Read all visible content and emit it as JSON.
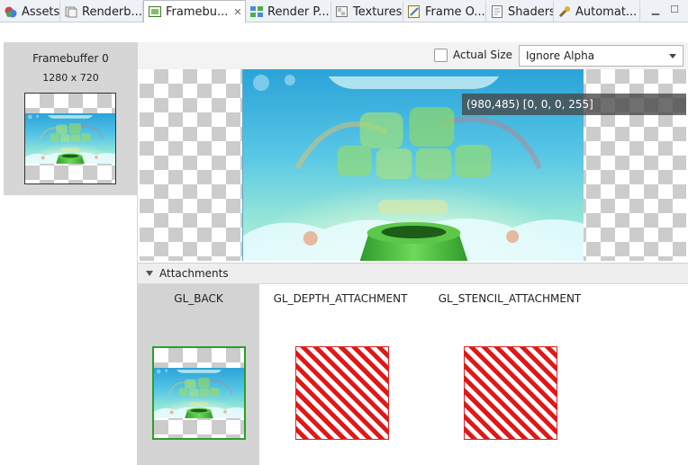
{
  "tabs": [
    {
      "label": "Assets",
      "icon": "assets-icon",
      "active": false
    },
    {
      "label": "Renderb...",
      "icon": "renderbuffer-icon",
      "active": false
    },
    {
      "label": "Framebu...",
      "icon": "framebuffer-icon",
      "active": true
    },
    {
      "label": "Render P...",
      "icon": "render-pipeline-icon",
      "active": false
    },
    {
      "label": "Textures",
      "icon": "textures-icon",
      "active": false
    },
    {
      "label": "Frame O...",
      "icon": "frame-overview-icon",
      "active": false
    },
    {
      "label": "Shaders",
      "icon": "shaders-icon",
      "active": false
    },
    {
      "label": "Automat...",
      "icon": "automation-icon",
      "active": false
    }
  ],
  "framebuffer_list": [
    {
      "title": "Framebuffer 0",
      "size": "1280 x 720"
    }
  ],
  "toolbar": {
    "actual_size_label": "Actual Size",
    "actual_size_checked": false,
    "alpha_mode": "Ignore Alpha"
  },
  "viewer": {
    "tooltip": "(980,485) [0, 0, 0, 255]"
  },
  "attachments": {
    "header": "Attachments",
    "expanded": true,
    "items": [
      {
        "label": "GL_BACK",
        "selected": true,
        "kind": "image"
      },
      {
        "label": "GL_DEPTH_ATTACHMENT",
        "selected": false,
        "kind": "unavailable"
      },
      {
        "label": "GL_STENCIL_ATTACHMENT",
        "selected": false,
        "kind": "unavailable"
      }
    ]
  },
  "colors": {
    "selection": "#d3d3d3",
    "selected_border": "#2aa12a",
    "hatch_red": "#e01818"
  }
}
